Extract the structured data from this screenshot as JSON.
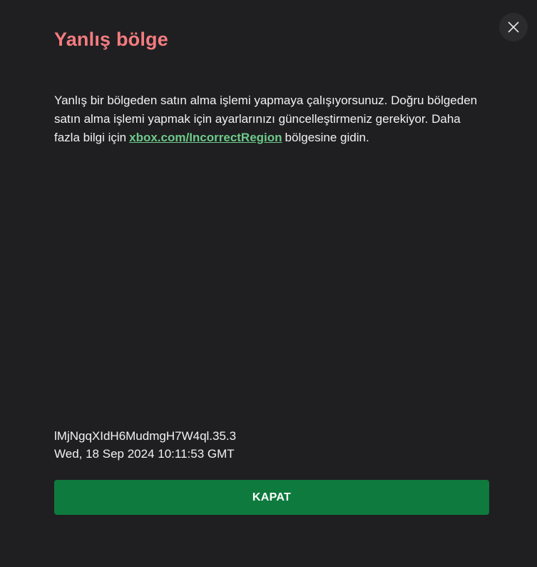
{
  "dialog": {
    "title": "Yanlış bölge",
    "message_before_link": "Yanlış bir bölgeden satın alma işlemi yapmaya çalışıyorsunuz. Doğru bölgeden satın alma işlemi yapmak için ayarlarınızı güncelleştirmeniz gerekiyor. Daha fazla bilgi için",
    "link_text": "xbox.com/IncorrectRegion",
    "message_after_link": "bölgesine gidin.",
    "reference_code": "lMjNgqXIdH6MudmgH7W4ql.35.3",
    "timestamp": "Wed, 18 Sep 2024 10:11:53 GMT",
    "primary_button_label": "KAPAT",
    "close_icon": "close-icon"
  },
  "colors": {
    "background": "#1f1f21",
    "title": "#f47c80",
    "link": "#6ec98a",
    "button": "#0e7a3d",
    "text": "#f2f2f2"
  }
}
